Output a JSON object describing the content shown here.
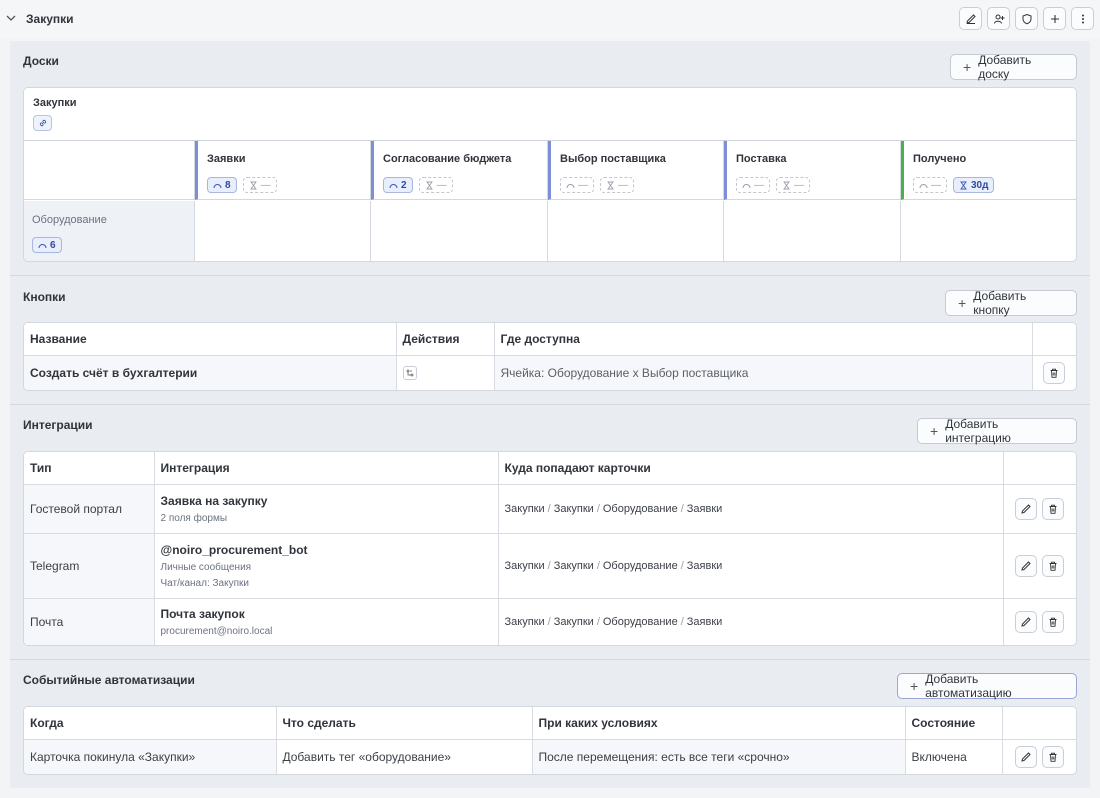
{
  "header": {
    "title": "Закупки"
  },
  "boards": {
    "section_title": "Доски",
    "add_label": "Добавить доску",
    "board_name": "Закупки",
    "columns": [
      {
        "name": "Заявки",
        "c1": "8",
        "c2": "—",
        "bar": "blue"
      },
      {
        "name": "Согласование бюджета",
        "c1": "2",
        "c2": "—",
        "bar": "blue"
      },
      {
        "name": "Выбор поставщика",
        "c1": "—",
        "c2": "—",
        "bar": "blue"
      },
      {
        "name": "Поставка",
        "c1": "—",
        "c2": "—",
        "bar": "blue"
      },
      {
        "name": "Получено",
        "c1": "—",
        "c2": "30д",
        "bar": "green"
      }
    ],
    "row_label": "Оборудование",
    "row_count": "6"
  },
  "buttons": {
    "section_title": "Кнопки",
    "add_label": "Добавить кнопку",
    "headers": [
      "Название",
      "Действия",
      "Где доступна"
    ],
    "rows": [
      {
        "name": "Создать счёт в бухгалтерии",
        "where": "Ячейка: Оборудование x Выбор поставщика"
      }
    ]
  },
  "integrations": {
    "section_title": "Интеграции",
    "add_label": "Добавить интеграцию",
    "headers": [
      "Тип",
      "Интеграция",
      "Куда попадают карточки"
    ],
    "rows": [
      {
        "type": "Гостевой портал",
        "name": "Заявка на закупку",
        "sub1": "2 поля формы",
        "sub2": "",
        "path": [
          "Закупки",
          "Закупки",
          "Оборудование",
          "Заявки"
        ]
      },
      {
        "type": "Telegram",
        "name": "@noiro_procurement_bot",
        "sub1": "Личные сообщения",
        "sub2": "Чат/канал: Закупки",
        "path": [
          "Закупки",
          "Закупки",
          "Оборудование",
          "Заявки"
        ]
      },
      {
        "type": "Почта",
        "name": "Почта закупок",
        "sub1": "procurement@noiro.local",
        "sub2": "",
        "path": [
          "Закупки",
          "Закупки",
          "Оборудование",
          "Заявки"
        ]
      }
    ]
  },
  "automations": {
    "section_title": "Событийные автоматизации",
    "add_label": "Добавить автоматизацию",
    "headers": [
      "Когда",
      "Что сделать",
      "При каких условиях",
      "Состояние"
    ],
    "rows": [
      {
        "when": "Карточка покинула «Закупки»",
        "what": "Добавить тег «оборудование»",
        "cond": "После перемещения: есть все теги «срочно»",
        "state": "Включена"
      }
    ]
  }
}
